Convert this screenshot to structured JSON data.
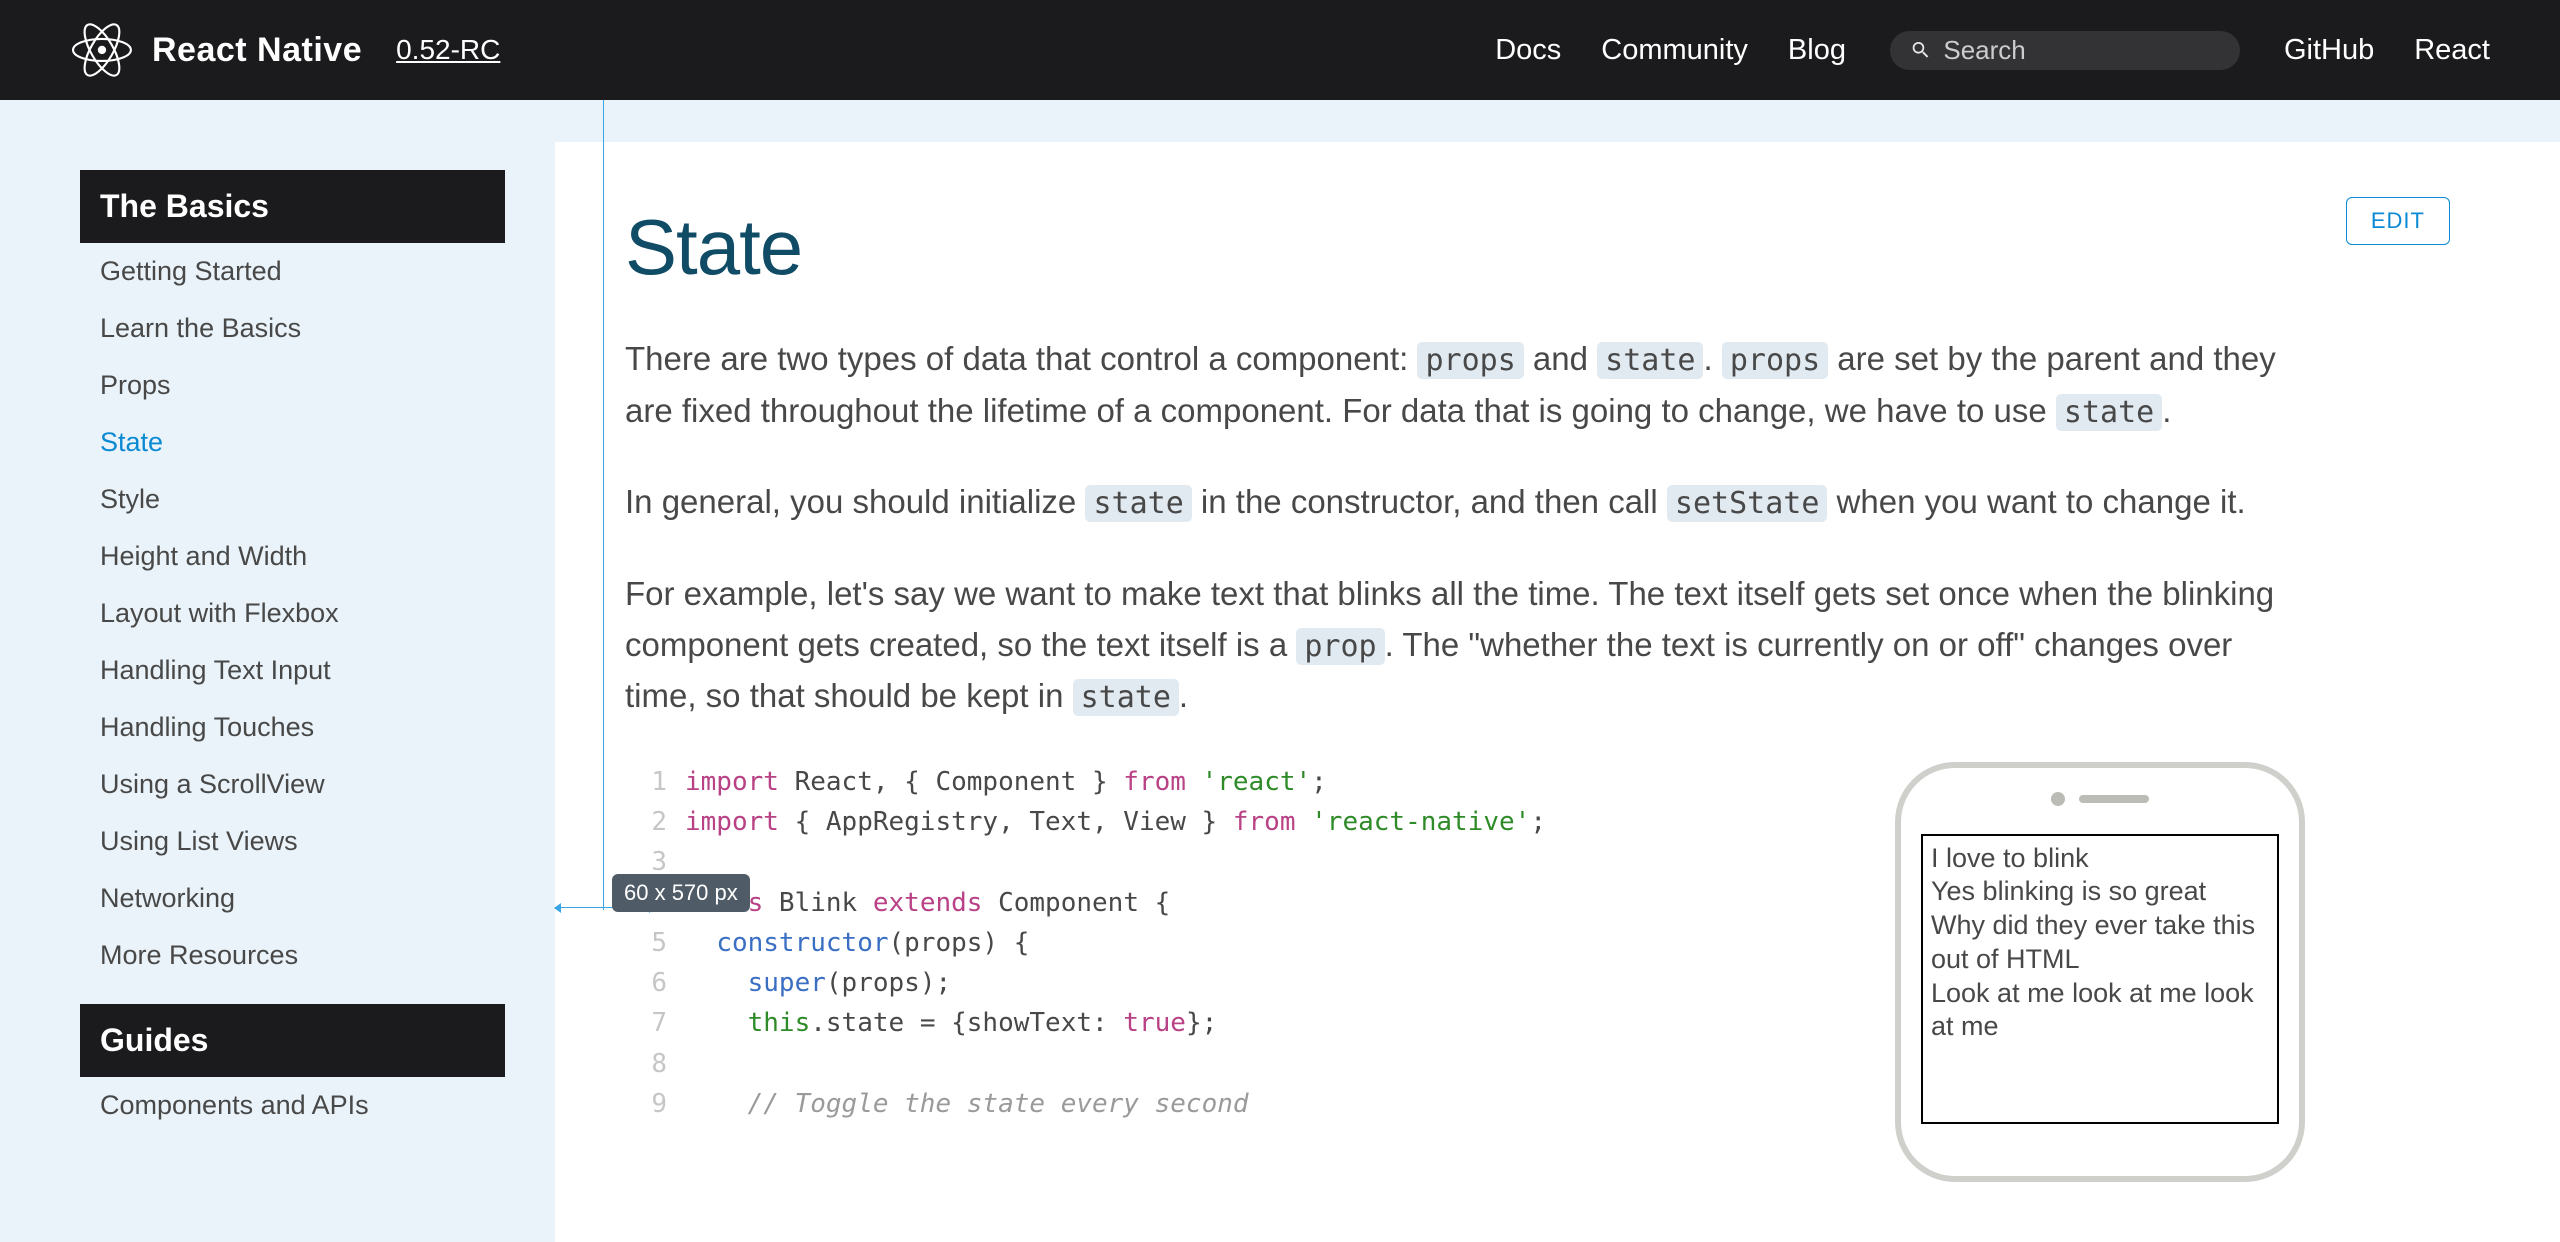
{
  "header": {
    "brand": "React Native",
    "version": "0.52-RC",
    "nav": {
      "docs": "Docs",
      "community": "Community",
      "blog": "Blog",
      "github": "GitHub",
      "react": "React"
    },
    "search_placeholder": "Search"
  },
  "sidebar": {
    "sections": [
      {
        "title": "The Basics",
        "items": [
          "Getting Started",
          "Learn the Basics",
          "Props",
          "State",
          "Style",
          "Height and Width",
          "Layout with Flexbox",
          "Handling Text Input",
          "Handling Touches",
          "Using a ScrollView",
          "Using List Views",
          "Networking",
          "More Resources"
        ],
        "active_index": 3
      },
      {
        "title": "Guides",
        "items": [
          "Components and APIs"
        ]
      }
    ]
  },
  "content": {
    "title": "State",
    "edit_label": "EDIT",
    "para1": {
      "t1": "There are two types of data that control a component: ",
      "c1": "props",
      "t2": " and ",
      "c2": "state",
      "t3": ". ",
      "c3": "props",
      "t4": " are set by the parent and they are fixed throughout the lifetime of a component. For data that is going to change, we have to use ",
      "c4": "state",
      "t5": "."
    },
    "para2": {
      "t1": "In general, you should initialize ",
      "c1": "state",
      "t2": " in the constructor, and then call ",
      "c2": "setState",
      "t3": " when you want to change it."
    },
    "para3": {
      "t1": "For example, let's say we want to make text that blinks all the time. The text itself gets set once when the blinking component gets created, so the text itself is a ",
      "c1": "prop",
      "t2": ". The \"whether the text is currently on or off\" changes over time, so that should be kept in ",
      "c2": "state",
      "t3": "."
    }
  },
  "code": {
    "l1_kw1": "import",
    "l1_plain1": " React, { Component } ",
    "l1_kw2": "from",
    "l1_str": " 'react'",
    "l1_end": ";",
    "l2_kw1": "import",
    "l2_plain1": " { AppRegistry, Text, View } ",
    "l2_kw2": "from",
    "l2_str": " 'react-native'",
    "l2_end": ";",
    "l4_kw1": "class",
    "l4_name": " Blink ",
    "l4_kw2": "extends",
    "l4_type": " Component ",
    "l4_brace": "{",
    "l5_indent": "  ",
    "l5_fn": "constructor",
    "l5_args": "(props) {",
    "l6_indent": "    ",
    "l6_fn": "super",
    "l6_args": "(props);",
    "l7_indent": "    ",
    "l7_this": "this",
    "l7_rest": ".state = {showText: ",
    "l7_bool": "true",
    "l7_end": "};",
    "l9_indent": "    ",
    "l9_comment": "// Toggle the state every second"
  },
  "phone": {
    "lines": [
      "I love to blink",
      "Yes blinking is so great",
      "Why did they ever take this out of HTML",
      "Look at me look at me look at me"
    ]
  },
  "measure": {
    "label": "60 x 570 px"
  }
}
